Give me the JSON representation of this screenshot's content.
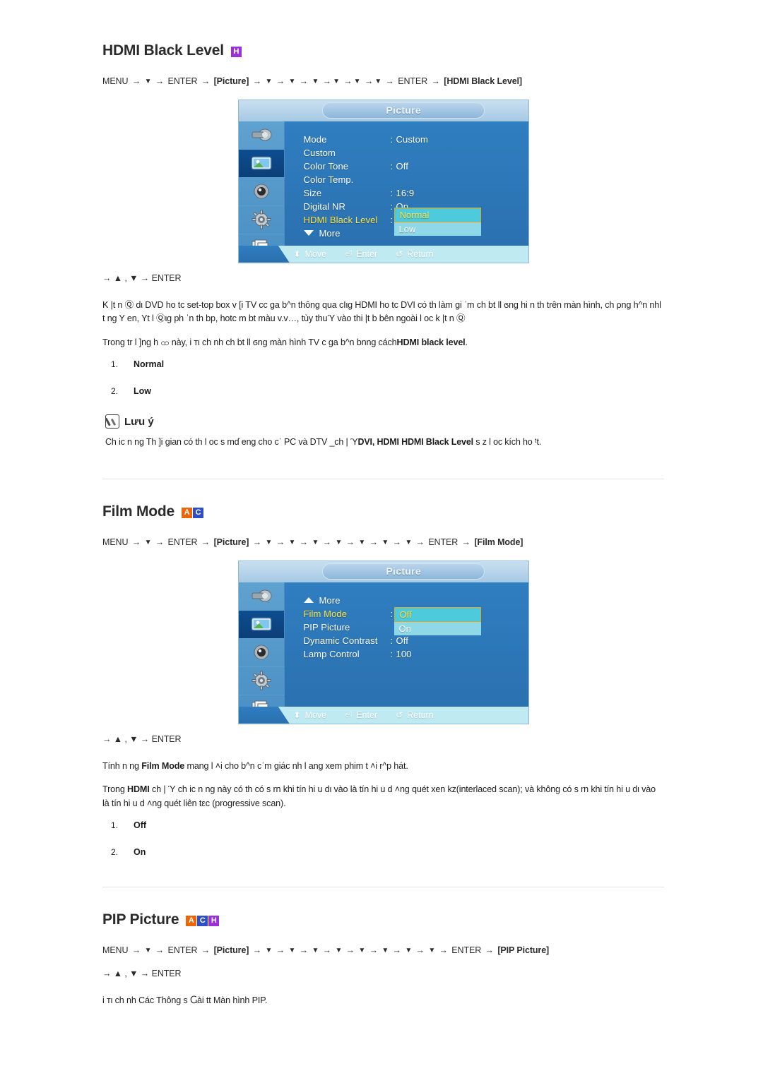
{
  "colors": {
    "badge_a": "#ec6608",
    "badge_c": "#2e4fc4",
    "badge_h": "#9b30d9",
    "osd_highlight_label": "#ffe23c",
    "osd_popup_bg": "#8fd8e8",
    "osd_popup_active": "#4ecadd",
    "osd_panel": "#2f7ec0"
  },
  "sections": {
    "hdmi_black_level": {
      "title": "HDMI Black Level",
      "badges": [
        "H"
      ],
      "path": {
        "menu": "MENU",
        "enter": "ENTER",
        "bracket1": "[Picture]",
        "bracket2": "[HDMI Black Level]",
        "down_count": 6
      },
      "key_line": "→ ▲ , ▼ → ENTER",
      "paragraphs": [
        "K |t n Ⓠ  dι DVD ho tc set-top box v [i TV cc ga b^n thông qua cΙιg HDMI ho tc DVI có th  làm gi ˈm ch bt ll ϭng hi n th  trên màn hình, ch ρng h^n nhl t ng   Y en,   Yt l Ⓠιg ph ˈn th bp, hotc m bt màu v.v…, tùy thuΎ vào thi |t b  bên ngoài   l ᴏc k |t n Ⓠ"
      ],
      "paragraph2_prefix": "Trong tr l ]ng h ထ này,   i ᴛι ch nh ch bt ll ϭng màn hình TV c ga b^n bnng cách",
      "paragraph2_bold": "HDMI black level",
      "paragraph2_suffix": ".",
      "options": [
        "Normal",
        "Low"
      ],
      "osd": {
        "window_title": "Picture",
        "rows": [
          {
            "label": "Mode",
            "value": "Custom",
            "highlight": false,
            "has_colon": true
          },
          {
            "label": "Custom",
            "value": "",
            "highlight": false,
            "has_colon": false
          },
          {
            "label": "Color Tone",
            "value": "Off",
            "highlight": false,
            "has_colon": true
          },
          {
            "label": "Color Temp.",
            "value": "",
            "highlight": false,
            "has_colon": false
          },
          {
            "label": "Size",
            "value": "16:9",
            "highlight": false,
            "has_colon": true
          },
          {
            "label": "Digital NR",
            "value": "On",
            "highlight": false,
            "has_colon": true
          },
          {
            "label": "HDMI Black Level",
            "value": "",
            "highlight": true,
            "has_colon": true
          }
        ],
        "more_label": "More",
        "more_direction": "down",
        "popup_options": [
          {
            "label": "Normal",
            "active": true
          },
          {
            "label": "Low",
            "active": false
          }
        ],
        "footer": [
          {
            "icon": "updown-arrow-icon",
            "label": "Move"
          },
          {
            "icon": "enter-key-icon",
            "label": "Enter"
          },
          {
            "icon": "return-arrow-icon",
            "label": "Return"
          }
        ],
        "rail_icons": [
          "input-source-icon",
          "picture-icon",
          "sound-icon",
          "setup-gear-icon",
          "multi-control-icon"
        ],
        "selected_rail_index": 1
      }
    },
    "note": {
      "title": "Lưu ý",
      "icon": "note-pen-icon",
      "text_before": "Ch ic n  ng Th ]i gian có th    l ᴏc s mɗ eng cho cˈ PC và DTV  _ch |     Ύ",
      "bold1": "DVI, HDMI HDMI Black Level",
      "text_after": " s z   l ᴏc kích ho ᵗt."
    },
    "film_mode": {
      "title": "Film Mode",
      "badges": [
        "A",
        "C"
      ],
      "path": {
        "menu": "MENU",
        "enter": "ENTER",
        "bracket1": "[Picture]",
        "bracket2": "[Film Mode]",
        "down_count": 7
      },
      "key_line": "→ ▲ , ▼ → ENTER",
      "p1_prefix": "Tính n  ng ",
      "p1_bold": "Film Mode",
      "p1_suffix": " mang l ˄i cho b^n cˈm giác nh l   ang xem phim t ˄i r^p hát.",
      "p2_prefix": "Trong ",
      "p2_bold": "HDMI",
      "p2_suffix": " ch |    Ύ ch ic n  ng này có th  có s rn khi tín hi u   dι vào là tín hi u d ˄ng quét xen kz(interlaced scan); và không có s rn khi tín hi u   dι vào là tín hi u d ˄ng quét liên tεc (progressive scan).",
      "options": [
        "Off",
        "On"
      ],
      "osd": {
        "window_title": "Picture",
        "rows": [
          {
            "label": "Film Mode",
            "value": "",
            "highlight": true,
            "has_colon": true
          },
          {
            "label": "PIP Picture",
            "value": "",
            "highlight": false,
            "has_colon": false
          },
          {
            "label": "Dynamic Contrast",
            "value": "Off",
            "highlight": false,
            "has_colon": true
          },
          {
            "label": "Lamp Control",
            "value": "100",
            "highlight": false,
            "has_colon": true
          }
        ],
        "more_label": "More",
        "more_direction": "up",
        "popup_options": [
          {
            "label": "Off",
            "active": true
          },
          {
            "label": "On",
            "active": false
          }
        ],
        "footer": [
          {
            "icon": "updown-arrow-icon",
            "label": "Move"
          },
          {
            "icon": "enter-key-icon",
            "label": "Enter"
          },
          {
            "icon": "return-arrow-icon",
            "label": "Return"
          }
        ],
        "rail_icons": [
          "input-source-icon",
          "picture-icon",
          "sound-icon",
          "setup-gear-icon",
          "multi-control-icon"
        ],
        "selected_rail_index": 1
      }
    },
    "pip_picture": {
      "title": "PIP Picture",
      "badges": [
        "A",
        "C",
        "H"
      ],
      "path": {
        "menu": "MENU",
        "enter": "ENTER",
        "bracket1": "[Picture]",
        "bracket2": "[PIP Picture]",
        "down_count": 8
      },
      "key_line": "→ ▲ , ▼ → ENTER",
      "body": "i ᴛι ch nh Các Thông s Ⴚài   tt Màn hình PIP."
    }
  }
}
